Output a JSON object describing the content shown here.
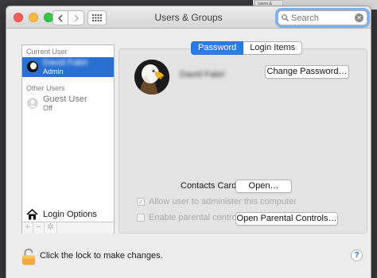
{
  "window": {
    "title": "Users & Groups"
  },
  "search": {
    "placeholder": "Search"
  },
  "sidebar": {
    "section_current": "Current User",
    "section_other": "Other Users",
    "current_user": {
      "name": "David Fabri",
      "role": "Admin"
    },
    "guest_user": {
      "name": "Guest User",
      "status": "Off"
    },
    "login_options": "Login Options",
    "footer": {
      "add": "+",
      "remove": "−",
      "gear": "✲"
    }
  },
  "tabs": [
    {
      "label": "Password",
      "active": true
    },
    {
      "label": "Login Items",
      "active": false
    }
  ],
  "main": {
    "full_name": "David Fabri",
    "change_password": "Change Password…",
    "contacts_label": "Contacts Card:",
    "open_label": "Open…",
    "allow_admin": {
      "label": "Allow user to administer this computer",
      "checked": true
    },
    "parental": {
      "label": "Enable parental controls",
      "checked": false
    },
    "open_parental": "Open Parental Controls…"
  },
  "footer": {
    "lock_text": "Click the lock to make changes.",
    "help": "?"
  },
  "desktop": {
    "thumb_text": "Users &"
  },
  "colors": {
    "selection": "#2a6fd2",
    "tab_active": "#2a7be8",
    "lock": "#f0a93a"
  }
}
